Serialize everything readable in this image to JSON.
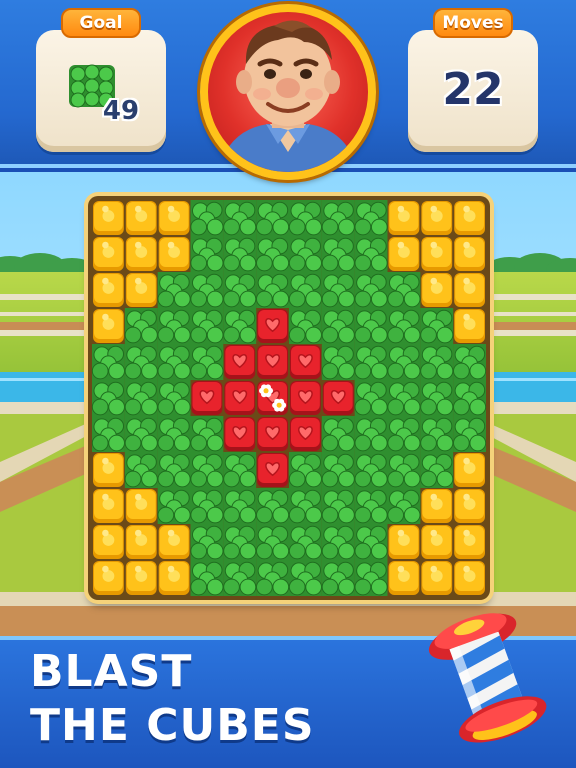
{
  "hud": {
    "goal_label": "Goal",
    "goal_item": "clover-icon",
    "goal_count": "49",
    "moves_label": "Moves",
    "moves_count": "22",
    "character": "character-avatar"
  },
  "board": {
    "legend": {
      "Y": "yellow-cube",
      "R": "red-heart-cube",
      "F": "red-heart-cube-with-flower",
      "G": "clover"
    },
    "rows": [
      "YYYGGGGGGYYY",
      "YYYGGGGGGYYY",
      "YYGGGGGGGGYY",
      "YGGGGRGGGGGY",
      "GGGGRRRGGGGG",
      "GGGRRFRRGGGG",
      "GGGGRRRGGGGG",
      "YGGGGRGGGGGY",
      "YYGGGGGGGGYY",
      "YYYGGGGGGYYY",
      "YYYGGGGGGYYY"
    ],
    "colors": {
      "yellow": "#ffc21a",
      "red": "#e8232c",
      "clover": "#3aa83a"
    }
  },
  "banner": {
    "line1": "BLAST",
    "line2": "THE CUBES",
    "booster": "rocket-booster-icon"
  }
}
